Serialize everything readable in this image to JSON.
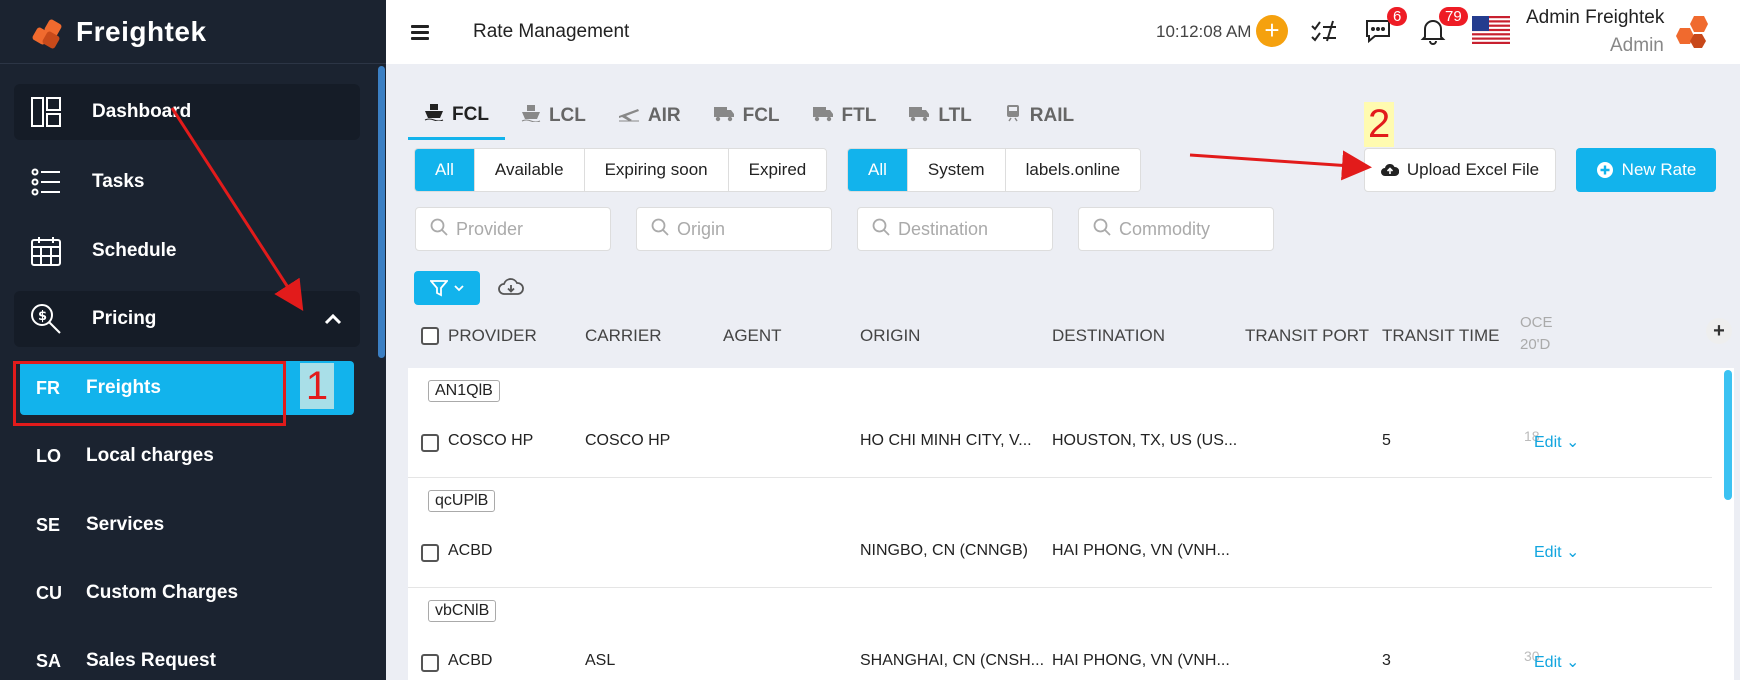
{
  "brand": "Freightek",
  "topbar": {
    "title": "Rate Management",
    "time": "10:12:08 AM",
    "messages_badge": "6",
    "notifications_badge": "79",
    "user_name": "Admin Freightek",
    "user_role": "Admin"
  },
  "sidebar": {
    "items": [
      {
        "label": "Dashboard",
        "icon": "dashboard-icon"
      },
      {
        "label": "Tasks",
        "icon": "tasks-icon"
      },
      {
        "label": "Schedule",
        "icon": "calendar-icon"
      },
      {
        "label": "Pricing",
        "icon": "pricing-search-icon"
      }
    ],
    "sub_items": [
      {
        "abbr": "FR",
        "label": "Freights"
      },
      {
        "abbr": "LO",
        "label": "Local charges"
      },
      {
        "abbr": "SE",
        "label": "Services"
      },
      {
        "abbr": "CU",
        "label": "Custom Charges"
      },
      {
        "abbr": "SA",
        "label": "Sales Request"
      }
    ]
  },
  "tabs": [
    {
      "label": "FCL",
      "icon": "ship-icon"
    },
    {
      "label": "LCL",
      "icon": "ship-icon"
    },
    {
      "label": "AIR",
      "icon": "plane-icon"
    },
    {
      "label": "FCL",
      "icon": "truck-icon"
    },
    {
      "label": "FTL",
      "icon": "truck-icon"
    },
    {
      "label": "LTL",
      "icon": "truck-icon"
    },
    {
      "label": "RAIL",
      "icon": "train-icon"
    }
  ],
  "status_filter": [
    "All",
    "Available",
    "Expiring soon",
    "Expired"
  ],
  "source_filter": [
    "All",
    "System",
    "labels.online"
  ],
  "buttons": {
    "upload": "Upload Excel File",
    "new_rate": "New Rate"
  },
  "search": {
    "provider": "Provider",
    "origin": "Origin",
    "destination": "Destination",
    "commodity": "Commodity"
  },
  "table": {
    "headers": [
      "PROVIDER",
      "CARRIER",
      "AGENT",
      "ORIGIN",
      "DESTINATION",
      "TRANSIT PORT",
      "TRANSIT TIME",
      "OCE",
      "20'D"
    ],
    "rows": [
      {
        "code": "AN1QlB",
        "provider": "COSCO HP",
        "carrier": "COSCO HP",
        "agent": "",
        "origin": "HO CHI MINH CITY, V...",
        "destination": "HOUSTON, TX, US (US...",
        "transit_port": "",
        "transit_time": "5",
        "ocean": "18",
        "action": "Edit"
      },
      {
        "code": "qcUPlB",
        "provider": "ACBD",
        "carrier": "",
        "agent": "",
        "origin": "NINGBO, CN (CNNGB)",
        "destination": "HAI PHONG, VN (VNH...",
        "transit_port": "",
        "transit_time": "",
        "ocean": "",
        "action": "Edit"
      },
      {
        "code": "vbCNlB",
        "provider": "ACBD",
        "carrier": "ASL",
        "agent": "",
        "origin": "SHANGHAI, CN (CNSH...",
        "destination": "HAI PHONG, VN (VNH...",
        "transit_port": "",
        "transit_time": "3",
        "ocean": "30",
        "action": "Edit"
      }
    ]
  },
  "annotations": {
    "step1": "1",
    "step2": "2"
  },
  "colors": {
    "accent": "#12b3ec",
    "sidebar": "#1b2330",
    "brand_orange": "#f06a2e",
    "annotation_red": "#e21b1b"
  }
}
